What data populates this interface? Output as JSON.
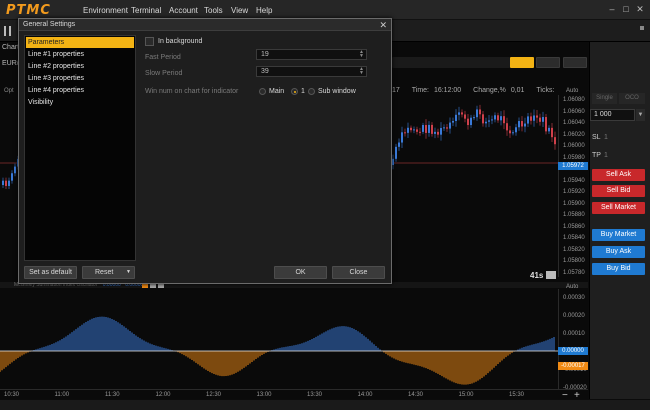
{
  "app": {
    "logo": "PTMC"
  },
  "menu": [
    "Environment",
    "Terminal",
    "Account",
    "Tools",
    "View",
    "Help"
  ],
  "window_controls": {
    "minimize": "–",
    "maximize": "□",
    "close": "✕"
  },
  "chart_window": {
    "tab": "Chart",
    "symbol": "EUR/",
    "opt": "Opt"
  },
  "chart_info": {
    "time_label": "Time:",
    "time_value": "16:12:00",
    "change_label": "Change,%",
    "change_value": "0,01",
    "ticks_label": "Ticks:",
    "partial": "17"
  },
  "price_axis": {
    "auto": "Auto",
    "labels": [
      "1.06080",
      "1.06060",
      "1.06040",
      "1.06020",
      "1.06000",
      "1.05980",
      "1.05960",
      "1.05940",
      "1.05920",
      "1.05900",
      "1.05880",
      "1.05860",
      "1.05840",
      "1.05820",
      "1.05800",
      "1.05780"
    ],
    "current_price": "1.05972"
  },
  "chart_status": {
    "countdown": "41s"
  },
  "indicator": {
    "title": "McGinley Summation Index Oscillator",
    "val1": "0.00000",
    "val2": "0.00000",
    "axis_auto": "Auto",
    "labels": [
      "0.00030",
      "0.00020",
      "0.00010",
      "0.00000",
      "-0.00010",
      "-0.00020"
    ],
    "marker_zero": "0.00000",
    "marker_neg": "-0.00017"
  },
  "time_axis": [
    "10:30",
    "11:00",
    "11:30",
    "12:00",
    "12:30",
    "13:00",
    "13:30",
    "14:00",
    "14:30",
    "15:00",
    "15:30"
  ],
  "right_panel": {
    "tab1": "Single",
    "tab2": "OCO",
    "quantity": "1 000",
    "sl": "SL",
    "sl_value": "1",
    "tp": "TP",
    "tp_value": "1",
    "buttons": {
      "sell_ask": "Sell Ask",
      "sell_bid": "Sell Bid",
      "sell_market": "Sell Market",
      "buy_market": "Buy Market",
      "buy_ask": "Buy Ask",
      "buy_bid": "Buy Bid"
    }
  },
  "dialog": {
    "title": "General Settings",
    "nav": [
      "Parameters",
      "Line #1 properties",
      "Line #2 properties",
      "Line #3 properties",
      "Line #4 properties",
      "Visibility"
    ],
    "in_background": "In background",
    "fast_period_label": "Fast Period",
    "fast_period_value": "19",
    "slow_period_label": "Slow Period",
    "slow_period_value": "39",
    "win_num_label": "Win num on chart for indicator",
    "radio_main": "Main",
    "radio_one": "1",
    "radio_sub": "Sub window",
    "set_default": "Set as default",
    "reset": "Reset",
    "ok": "OK",
    "close": "Close"
  },
  "colors": {
    "accent": "#f3b314",
    "bull": "#3b7bd9",
    "bear": "#d0404b",
    "osc_pos": "#3b7bd9",
    "osc_neg": "#f08a14"
  }
}
